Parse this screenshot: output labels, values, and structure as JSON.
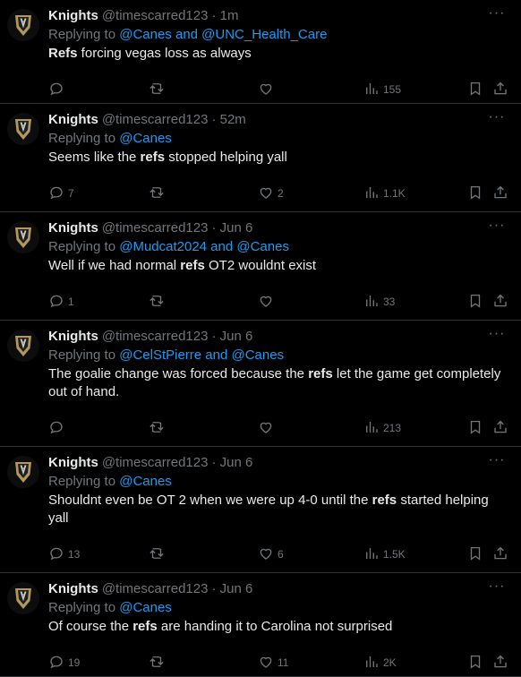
{
  "tweets": [
    {
      "name": "Knights",
      "handle": "@timescarred123",
      "time": "· 1m",
      "replying_prefix": "Replying to ",
      "replying_to": "@Canes and @UNC_Health_Care",
      "text_parts": [
        {
          "t": "Refs",
          "b": true
        },
        {
          "t": " forcing vegas loss as always",
          "b": false
        }
      ],
      "replies": "",
      "likes": "",
      "views": "155"
    },
    {
      "name": "Knights",
      "handle": "@timescarred123",
      "time": "· 52m",
      "replying_prefix": "Replying to ",
      "replying_to": "@Canes",
      "text_parts": [
        {
          "t": "Seems like the ",
          "b": false
        },
        {
          "t": "refs",
          "b": true
        },
        {
          "t": " stopped helping yall",
          "b": false
        }
      ],
      "replies": "7",
      "likes": "2",
      "views": "1.1K"
    },
    {
      "name": "Knights",
      "handle": "@timescarred123",
      "time": "· Jun 6",
      "replying_prefix": "Replying to ",
      "replying_to": "@Mudcat2024 and @Canes",
      "text_parts": [
        {
          "t": "Well if we had normal ",
          "b": false
        },
        {
          "t": "refs",
          "b": true
        },
        {
          "t": " OT2 wouldnt exist",
          "b": false
        }
      ],
      "replies": "1",
      "likes": "",
      "views": "33"
    },
    {
      "name": "Knights",
      "handle": "@timescarred123",
      "time": "· Jun 6",
      "replying_prefix": "Replying to ",
      "replying_to": "@CelStPierre and @Canes",
      "text_parts": [
        {
          "t": "The goalie change was forced because the ",
          "b": false
        },
        {
          "t": "refs",
          "b": true
        },
        {
          "t": " let the game get completely out of hand.",
          "b": false
        }
      ],
      "replies": "",
      "likes": "",
      "views": "213"
    },
    {
      "name": "Knights",
      "handle": "@timescarred123",
      "time": "· Jun 6",
      "replying_prefix": "Replying to ",
      "replying_to": "@Canes",
      "text_parts": [
        {
          "t": "Shouldnt even be OT 2 when we were up 4-0 until the ",
          "b": false
        },
        {
          "t": "refs",
          "b": true
        },
        {
          "t": " started helping yall",
          "b": false
        }
      ],
      "replies": "13",
      "likes": "6",
      "views": "1.5K"
    },
    {
      "name": "Knights",
      "handle": "@timescarred123",
      "time": "· Jun 6",
      "replying_prefix": "Replying to ",
      "replying_to": "@Canes",
      "text_parts": [
        {
          "t": "Of course the ",
          "b": false
        },
        {
          "t": "refs",
          "b": true
        },
        {
          "t": " are handing it to Carolina not surprised",
          "b": false
        }
      ],
      "replies": "19",
      "likes": "11",
      "views": "2K"
    }
  ],
  "colors": {
    "background": "#000000",
    "text": "#e7e9ea",
    "muted": "#71767b",
    "link": "#1d9bf0",
    "divider": "#2f3336",
    "avatar_gold": "#b4975a"
  },
  "icons": [
    "more-icon",
    "reply-icon",
    "retweet-icon",
    "like-icon",
    "views-icon",
    "bookmark-icon",
    "share-icon"
  ]
}
